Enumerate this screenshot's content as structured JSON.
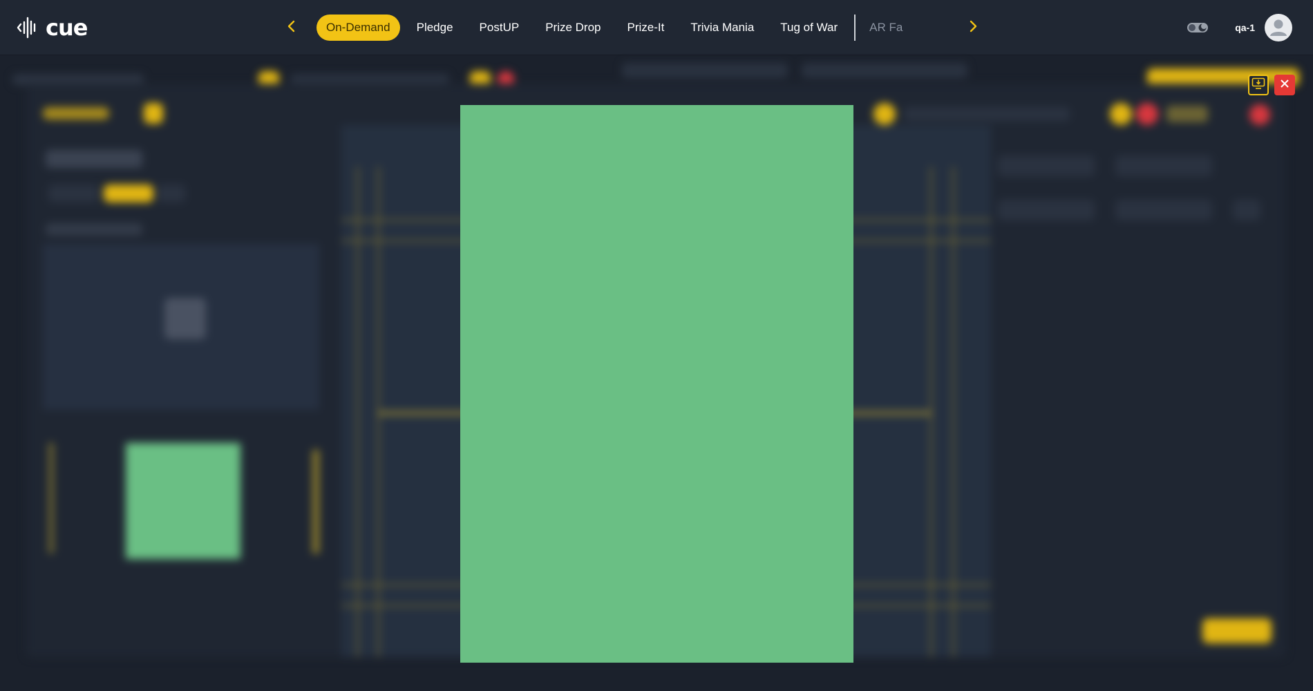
{
  "app": {
    "logo_text": "cue",
    "logo_icon": "sound-wave-icon"
  },
  "nav": {
    "prev_icon": "chevron-left-icon",
    "next_icon": "chevron-right-icon",
    "tabs": [
      {
        "label": "On-Demand",
        "active": true
      },
      {
        "label": "Pledge"
      },
      {
        "label": "PostUP"
      },
      {
        "label": "Prize Drop"
      },
      {
        "label": "Prize-It"
      },
      {
        "label": "Trivia Mania"
      },
      {
        "label": "Tug of War"
      },
      {
        "label": "AR Fa",
        "truncated": true
      }
    ]
  },
  "header_right": {
    "theme_toggle_icon": "theme-toggle-icon",
    "user": "qa-1",
    "avatar_icon": "user-avatar-icon"
  },
  "modal": {
    "download_icon": "download-screen-icon",
    "close_icon": "close-icon",
    "preview_color": "#6abf84"
  },
  "colors": {
    "accent": "#f2c315",
    "danger": "#e53935",
    "background": "#1b212c",
    "nav_background": "#202733"
  }
}
